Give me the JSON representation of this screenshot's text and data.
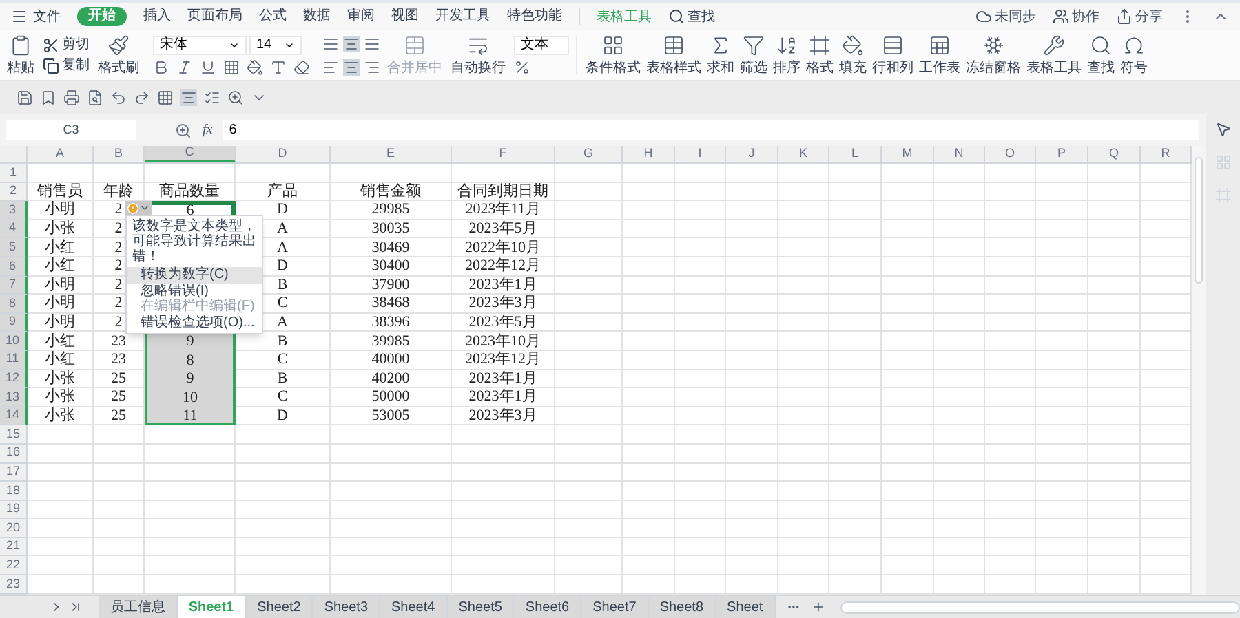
{
  "menu": {
    "items": [
      {
        "label": "文件",
        "selected": false,
        "kind": "file"
      },
      {
        "label": "开始",
        "selected": true,
        "kind": "tab"
      },
      {
        "label": "插入",
        "selected": false,
        "kind": "tab"
      },
      {
        "label": "页面布局",
        "selected": false,
        "kind": "tab"
      },
      {
        "label": "公式",
        "selected": false,
        "kind": "tab"
      },
      {
        "label": "数据",
        "selected": false,
        "kind": "tab"
      },
      {
        "label": "审阅",
        "selected": false,
        "kind": "tab"
      },
      {
        "label": "视图",
        "selected": false,
        "kind": "tab"
      },
      {
        "label": "开发工具",
        "selected": false,
        "kind": "tab"
      },
      {
        "label": "特色功能",
        "selected": false,
        "kind": "tab"
      },
      {
        "label": "表格工具",
        "selected": false,
        "kind": "context"
      },
      {
        "label": "查找",
        "selected": false,
        "kind": "search"
      }
    ],
    "sync": "未同步",
    "collab": "协作",
    "share": "分享"
  },
  "ribbon": {
    "paste": "粘贴",
    "cut": "剪切",
    "copy": "复制",
    "painter": "格式刷",
    "font_name": "宋体",
    "font_size": "14",
    "merge": {
      "label": "合并居中",
      "disabled": true
    },
    "wrap": "自动换行",
    "number_format": "文本",
    "tools": [
      "条件格式",
      "表格样式",
      "求和",
      "筛选",
      "排序",
      "格式",
      "填充",
      "行和列",
      "工作表",
      "冻结窗格",
      "表格工具",
      "查找",
      "符号"
    ]
  },
  "formula_bar": {
    "cell": "C3",
    "function_label": "fx",
    "value": "6"
  },
  "sheet": {
    "columns": [
      {
        "label": "A",
        "selected": false
      },
      {
        "label": "B",
        "selected": false
      },
      {
        "label": "C",
        "selected": true
      },
      {
        "label": "D",
        "selected": false
      },
      {
        "label": "E",
        "selected": false
      },
      {
        "label": "F",
        "selected": false
      },
      {
        "label": "G",
        "selected": false
      },
      {
        "label": "H",
        "selected": false
      },
      {
        "label": "I",
        "selected": false
      },
      {
        "label": "J",
        "selected": false
      },
      {
        "label": "K",
        "selected": false
      },
      {
        "label": "L",
        "selected": false
      },
      {
        "label": "M",
        "selected": false
      },
      {
        "label": "N",
        "selected": false
      },
      {
        "label": "O",
        "selected": false
      },
      {
        "label": "P",
        "selected": false
      },
      {
        "label": "Q",
        "selected": false
      },
      {
        "label": "R",
        "selected": false
      }
    ],
    "rows": [
      {
        "number": "1",
        "selected": false
      },
      {
        "number": "2",
        "selected": false,
        "cells": [
          "销售员",
          "年龄",
          "商品数量",
          "产品",
          "销售金额",
          "合同到期日期"
        ]
      },
      {
        "number": "3",
        "selected": true,
        "active": true,
        "cells": [
          "小明",
          "2",
          "6",
          "D",
          "29985",
          "2023年11月"
        ]
      },
      {
        "number": "4",
        "selected": true,
        "cells": [
          "小张",
          "2",
          null,
          "A",
          "30035",
          "2023年5月"
        ]
      },
      {
        "number": "5",
        "selected": true,
        "cells": [
          "小红",
          "2",
          null,
          "A",
          "30469",
          "2022年10月"
        ]
      },
      {
        "number": "6",
        "selected": true,
        "cells": [
          "小红",
          "2",
          null,
          "D",
          "30400",
          "2022年12月"
        ]
      },
      {
        "number": "7",
        "selected": true,
        "cells": [
          "小明",
          "2",
          null,
          "B",
          "37900",
          "2023年1月"
        ]
      },
      {
        "number": "8",
        "selected": true,
        "cells": [
          "小明",
          "2",
          null,
          "C",
          "38468",
          "2023年3月"
        ]
      },
      {
        "number": "9",
        "selected": true,
        "cells": [
          "小明",
          "2",
          null,
          "A",
          "38396",
          "2023年5月"
        ]
      },
      {
        "number": "10",
        "selected": true,
        "cells": [
          "小红",
          "23",
          "9",
          "B",
          "39985",
          "2023年10月"
        ]
      },
      {
        "number": "11",
        "selected": true,
        "cells": [
          "小红",
          "23",
          "8",
          "C",
          "40000",
          "2023年12月"
        ]
      },
      {
        "number": "12",
        "selected": true,
        "cells": [
          "小张",
          "25",
          "9",
          "B",
          "40200",
          "2023年1月"
        ]
      },
      {
        "number": "13",
        "selected": true,
        "cells": [
          "小张",
          "25",
          "10",
          "C",
          "50000",
          "2023年1月"
        ]
      },
      {
        "number": "14",
        "selected": true,
        "cells": [
          "小张",
          "25",
          "11",
          "D",
          "53005",
          "2023年3月"
        ]
      },
      {
        "number": "15",
        "selected": false
      },
      {
        "number": "16",
        "selected": false
      },
      {
        "number": "17",
        "selected": false
      },
      {
        "number": "18",
        "selected": false
      },
      {
        "number": "19",
        "selected": false
      },
      {
        "number": "20",
        "selected": false
      },
      {
        "number": "21",
        "selected": false
      },
      {
        "number": "22",
        "selected": false
      },
      {
        "number": "23",
        "selected": false
      }
    ]
  },
  "error_menu": {
    "message": "该数字是文本类型，可能导致计算结果出错！",
    "items": [
      {
        "label": "转换为数字(C)",
        "selected": true,
        "disabled": false
      },
      {
        "label": "忽略错误(I)",
        "selected": false,
        "disabled": false
      },
      {
        "label": "在编辑栏中编辑(F)",
        "selected": false,
        "disabled": true
      },
      {
        "label": "错误检查选项(O)...",
        "selected": false,
        "disabled": false
      }
    ]
  },
  "sheet_tabs": [
    {
      "label": "员工信息",
      "selected": false
    },
    {
      "label": "Sheet1",
      "selected": true
    },
    {
      "label": "Sheet2",
      "selected": false
    },
    {
      "label": "Sheet3",
      "selected": false
    },
    {
      "label": "Sheet4",
      "selected": false
    },
    {
      "label": "Sheet5",
      "selected": false
    },
    {
      "label": "Sheet6",
      "selected": false
    },
    {
      "label": "Sheet7",
      "selected": false
    },
    {
      "label": "Sheet8",
      "selected": false
    },
    {
      "label": "Sheet",
      "selected": false
    }
  ]
}
